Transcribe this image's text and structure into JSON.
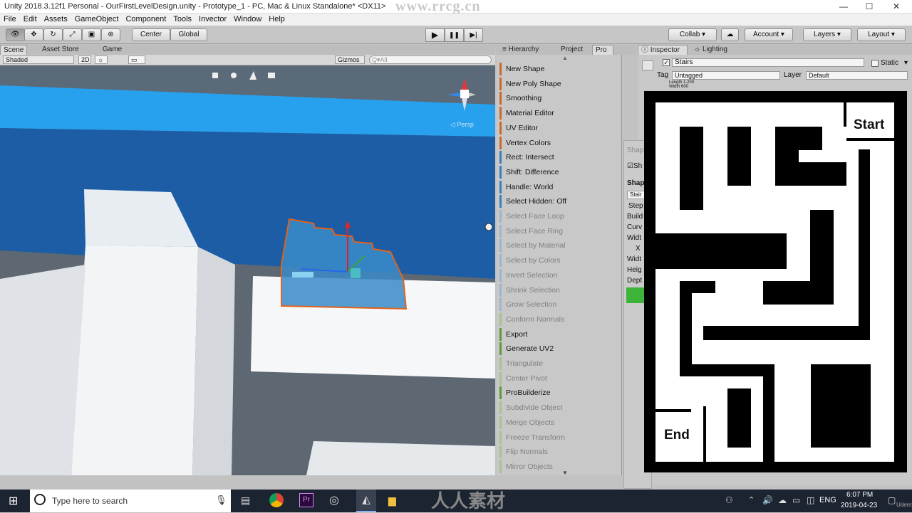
{
  "window": {
    "title": "Unity 2018.3.12f1 Personal - OurFirstLevelDesign.unity - Prototype_1 - PC, Mac & Linux Standalone* <DX11>",
    "watermark_top": "www.rrcg.cn",
    "minimize": "—",
    "maximize": "☐",
    "close": "✕"
  },
  "menu": [
    "File",
    "Edit",
    "Assets",
    "GameObject",
    "Component",
    "Tools",
    "Invector",
    "Window",
    "Help"
  ],
  "toolbar": {
    "pivot": "Center",
    "space": "Global",
    "collab": "Collab ▾",
    "account": "Account",
    "layers": "Layers",
    "layout": "Layout",
    "play": "▶",
    "pause": "❚❚",
    "step": "▶|"
  },
  "scene": {
    "tabs": [
      "Scene",
      "Asset Store",
      "Game"
    ],
    "shading": "Shaded",
    "mode2d": "2D",
    "gizmos": "Gizmos ▾",
    "search_placeholder": "All",
    "persp": "◁ Persp"
  },
  "hierarchy": {
    "tabs": [
      "Hierarchy",
      "Project",
      "Pro"
    ]
  },
  "probuilder": {
    "items": [
      {
        "label": "New Shape",
        "color": "#c76b2d",
        "enabled": true
      },
      {
        "label": "New Poly Shape",
        "color": "#c76b2d",
        "enabled": true
      },
      {
        "label": "Smoothing",
        "color": "#c76b2d",
        "enabled": true
      },
      {
        "label": "Material Editor",
        "color": "#c76b2d",
        "enabled": true
      },
      {
        "label": "UV Editor",
        "color": "#c76b2d",
        "enabled": true
      },
      {
        "label": "Vertex Colors",
        "color": "#c76b2d",
        "enabled": true
      },
      {
        "label": "Rect: Intersect",
        "color": "#3c80b8",
        "enabled": true
      },
      {
        "label": "Shift: Difference",
        "color": "#3c80b8",
        "enabled": true
      },
      {
        "label": "Handle: World",
        "color": "#3c80b8",
        "enabled": true
      },
      {
        "label": "Select Hidden: Off",
        "color": "#3c80b8",
        "enabled": true
      },
      {
        "label": "Select Face Loop",
        "color": "#9ab6cf",
        "enabled": false
      },
      {
        "label": "Select Face Ring",
        "color": "#9ab6cf",
        "enabled": false
      },
      {
        "label": "Select by Material",
        "color": "#9ab6cf",
        "enabled": false
      },
      {
        "label": "Select by Colors",
        "color": "#9ab6cf",
        "enabled": false
      },
      {
        "label": "Invert Selection",
        "color": "#9ab6cf",
        "enabled": false
      },
      {
        "label": "Shrink Selection",
        "color": "#9ab6cf",
        "enabled": false
      },
      {
        "label": "Grow Selection",
        "color": "#9ab6cf",
        "enabled": false
      },
      {
        "label": "Conform Normals",
        "color": "#a6c48e",
        "enabled": false
      },
      {
        "label": "Export",
        "color": "#5a9a3a",
        "enabled": true
      },
      {
        "label": "Generate UV2",
        "color": "#5a9a3a",
        "enabled": true
      },
      {
        "label": "Triangulate",
        "color": "#a6c48e",
        "enabled": false
      },
      {
        "label": "Center Pivot",
        "color": "#a6c48e",
        "enabled": false
      },
      {
        "label": "ProBuilderize",
        "color": "#5a9a3a",
        "enabled": true
      },
      {
        "label": "Subdivide Object",
        "color": "#a6c48e",
        "enabled": false
      },
      {
        "label": "Merge Objects",
        "color": "#a6c48e",
        "enabled": false
      },
      {
        "label": "Freeze Transform",
        "color": "#a6c48e",
        "enabled": false
      },
      {
        "label": "Flip Normals",
        "color": "#a6c48e",
        "enabled": false
      },
      {
        "label": "Mirror Objects",
        "color": "#a6c48e",
        "enabled": false
      }
    ]
  },
  "inspector": {
    "tabs": [
      "Inspector",
      "Lighting"
    ],
    "object_name": "Stairs",
    "static_label": "Static",
    "tag_label": "Tag",
    "tag_value": "Untagged",
    "layer_label": "Layer",
    "layer_value": "Default",
    "dims_length": "Length 1.200",
    "dims_width": "Width 600"
  },
  "shape_panel": {
    "title": "Shap",
    "check": "Sh",
    "section": "Shap",
    "type": "Stair",
    "rows": [
      "Step",
      "Build",
      "Curv",
      "Widt",
      "X",
      "Widt",
      "Heig",
      "Dept"
    ]
  },
  "maze": {
    "start": "Start",
    "end": "End"
  },
  "taskbar": {
    "search_placeholder": "Type here to search",
    "lang": "ENG",
    "time": "6:07 PM",
    "date": "2019-04-23",
    "watermark": "人人素材",
    "udemy": "Udemy"
  }
}
